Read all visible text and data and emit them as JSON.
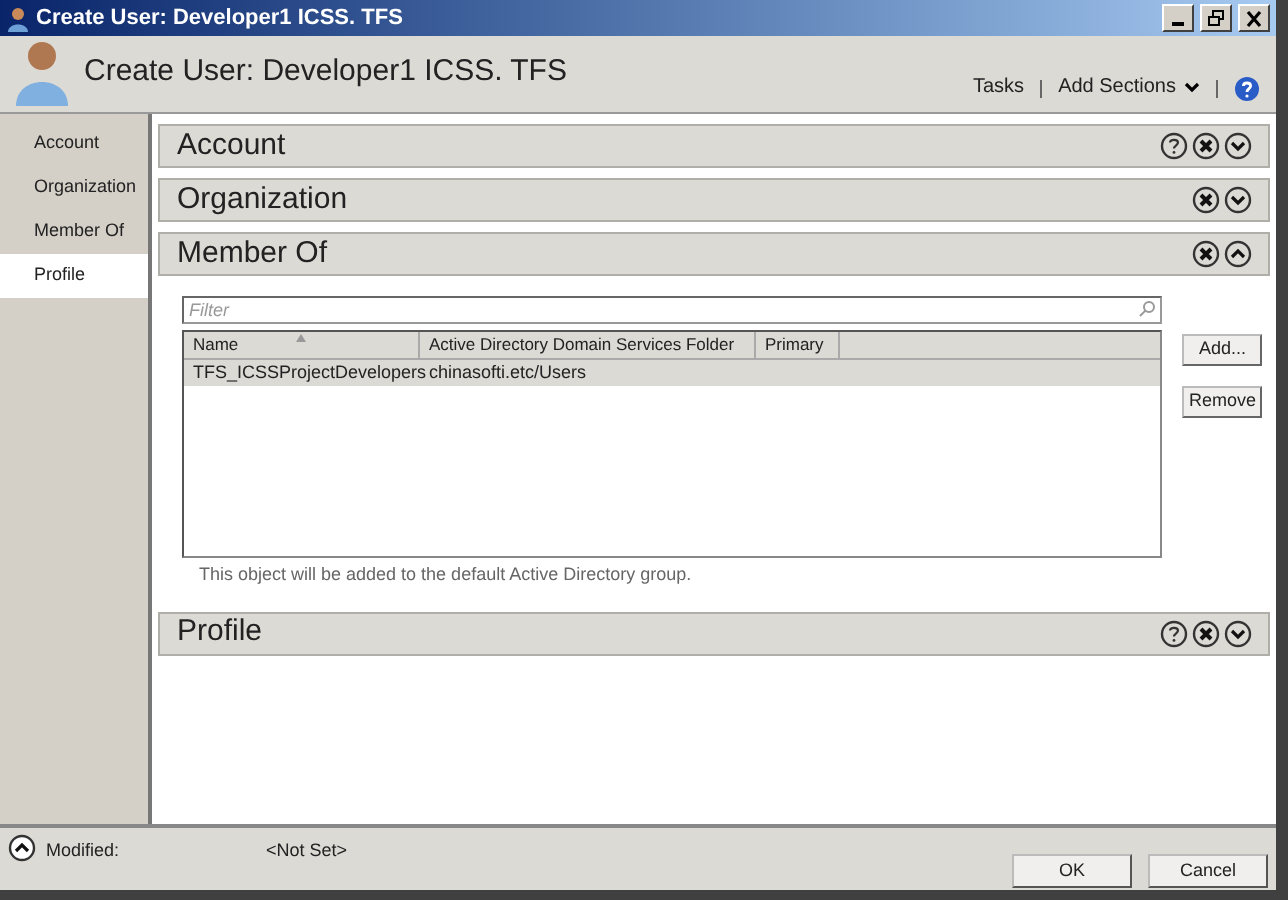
{
  "window": {
    "title": "Create User: Developer1 ICSS. TFS"
  },
  "header": {
    "title": "Create User: Developer1 ICSS. TFS",
    "tasks": "Tasks",
    "add_sections": "Add Sections"
  },
  "sidebar": {
    "items": [
      {
        "label": "Account",
        "selected": false
      },
      {
        "label": "Organization",
        "selected": false
      },
      {
        "label": "Member Of",
        "selected": false
      },
      {
        "label": "Profile",
        "selected": true
      }
    ]
  },
  "sections": [
    {
      "title": "Account",
      "help": true,
      "expanded": false
    },
    {
      "title": "Organization",
      "help": false,
      "expanded": false
    },
    {
      "title": "Member Of",
      "help": false,
      "expanded": true,
      "filter": {
        "placeholder": "Filter"
      },
      "table": {
        "columns": [
          "Name",
          "Active Directory Domain Services Folder",
          "Primary"
        ],
        "rows": [
          {
            "cells": [
              "TFS_ICSSProjectDevelopers",
              "chinasofti.etc/Users",
              ""
            ],
            "selected": true
          }
        ]
      },
      "buttons": [
        "Add...",
        "Remove"
      ],
      "note": "This object will be added to the default Active Directory group."
    },
    {
      "title": "Profile",
      "help": true,
      "expanded": false
    }
  ],
  "footer": {
    "label": "Modified:",
    "value": "<Not Set>",
    "buttons": [
      "OK",
      "Cancel"
    ]
  }
}
